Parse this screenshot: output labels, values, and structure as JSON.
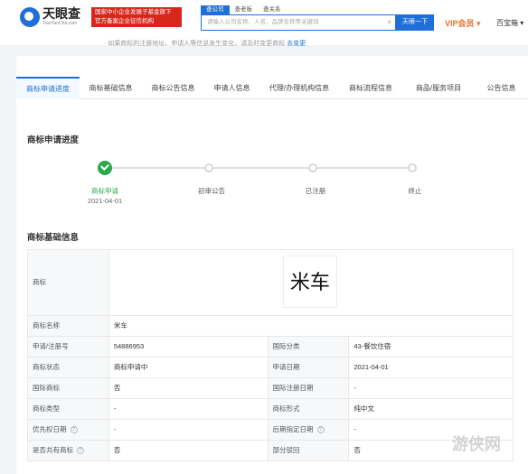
{
  "header": {
    "logo_name": "天眼查",
    "logo_sub": "TianYanCha.com",
    "gov_badge_line1": "国家中小企业发展子基金旗下",
    "gov_badge_line2": "官方备案企业征信机构",
    "search_tabs": [
      "查公司",
      "查老板",
      "查关系"
    ],
    "search_placeholder": "请输入公司名称、人名、品牌名称等关键词",
    "search_button": "天眼一下",
    "vip": "VIP会员 ▾",
    "user": "百宝箱 ▾"
  },
  "notice": {
    "text": "如果商标的注册地址、申请人等信息发生变化，请及时变更商标",
    "link": "去变更"
  },
  "tabs": [
    "商标申请进度",
    "商标基础信息",
    "商标公告信息",
    "申请人信息",
    "代理/办理机构信息",
    "商标流程信息",
    "商品/服务项目",
    "公告信息"
  ],
  "progress": {
    "title": "商标申请进度",
    "steps": [
      {
        "label": "商标申请",
        "date": "2021-04-01"
      },
      {
        "label": "初审公告",
        "date": ""
      },
      {
        "label": "已注册",
        "date": ""
      },
      {
        "label": "终止",
        "date": ""
      }
    ]
  },
  "basic": {
    "title": "商标基础信息",
    "trademark_label": "商标",
    "trademark_text": "米车",
    "name_label": "商标名称",
    "name_value": "米车",
    "rows": [
      {
        "l1": "申请/注册号",
        "v1": "54886953",
        "l2": "国际分类",
        "v2": "43-餐饮住宿"
      },
      {
        "l1": "商标状态",
        "v1": "商标申请中",
        "l2": "申请日期",
        "v2": "2021-04-01"
      },
      {
        "l1": "国际商标",
        "v1": "否",
        "l2": "国际注册日期",
        "v2": "-"
      },
      {
        "l1": "商标类型",
        "v1": "-",
        "l2": "商标形式",
        "v2": "纯中文"
      },
      {
        "l1": "优先权日期",
        "v1": "-",
        "l2": "后期指定日期",
        "v2": "-"
      },
      {
        "l1": "是否共有商标",
        "v1": "否",
        "l2": "部分驳回",
        "v2": "否"
      }
    ]
  },
  "watermark": "游侠网"
}
